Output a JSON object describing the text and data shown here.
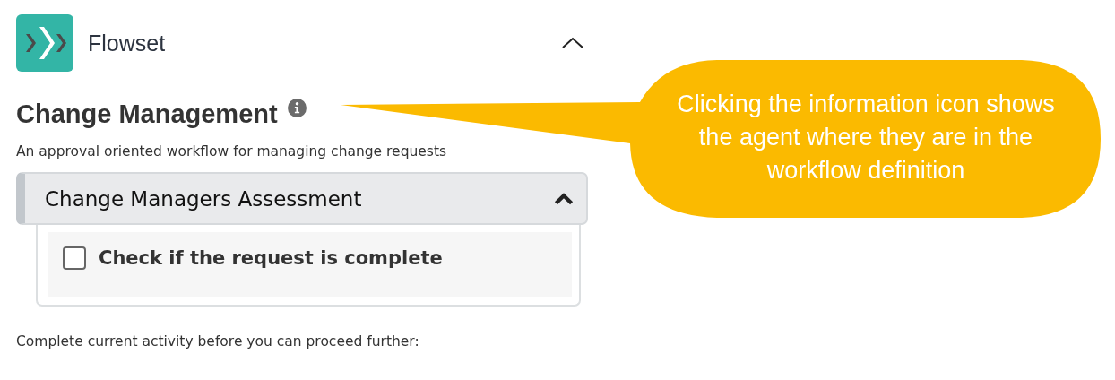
{
  "app": {
    "name": "Flowset",
    "expanded": true
  },
  "workflow": {
    "title": "Change Management",
    "description": "An approval oriented workflow for managing change requests"
  },
  "stage": {
    "title": "Change Managers Assessment",
    "expanded": true,
    "tasks": [
      {
        "label": "Check if the request is complete",
        "checked": false
      }
    ]
  },
  "footer_note": "Complete current activity before you can proceed further:",
  "callout": {
    "text": "Clicking the information icon shows the agent where they are in the workflow definition"
  }
}
